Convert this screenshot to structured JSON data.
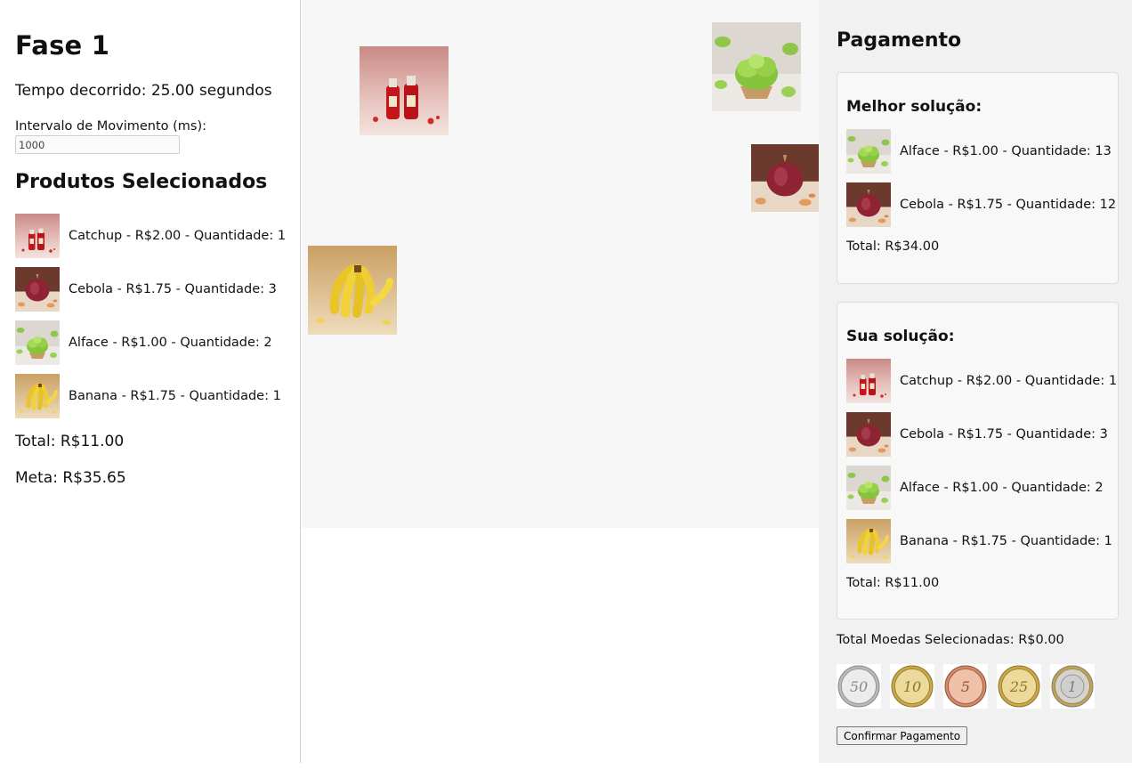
{
  "left": {
    "title": "Fase 1",
    "elapsed": "Tempo decorrido: 25.00 segundos",
    "interval_label": "Intervalo de Movimento (ms):",
    "interval_value": "1000",
    "selected_heading": "Produtos Selecionados",
    "items": [
      {
        "icon": "ketchup-image",
        "text": "Catchup - R$2.00 - Quantidade: 1"
      },
      {
        "icon": "onion-image",
        "text": "Cebola - R$1.75 - Quantidade: 3"
      },
      {
        "icon": "lettuce-image",
        "text": "Alface - R$1.00 - Quantidade: 2"
      },
      {
        "icon": "banana-image",
        "text": "Banana - R$1.75 - Quantidade: 1"
      }
    ],
    "total": "Total: R$11.00",
    "goal": "Meta: R$35.65"
  },
  "game_area": {
    "products": [
      "ketchup-image",
      "lettuce-image",
      "onion-image",
      "banana-image"
    ]
  },
  "payment": {
    "heading": "Pagamento",
    "best": {
      "heading": "Melhor solução:",
      "items": [
        {
          "icon": "lettuce-image",
          "text": "Alface - R$1.00 - Quantidade: 13"
        },
        {
          "icon": "onion-image",
          "text": "Cebola - R$1.75 - Quantidade: 12"
        }
      ],
      "total": "Total: R$34.00"
    },
    "yours": {
      "heading": "Sua solução:",
      "items": [
        {
          "icon": "ketchup-image",
          "text": "Catchup - R$2.00 - Quantidade: 1"
        },
        {
          "icon": "onion-image",
          "text": "Cebola - R$1.75 - Quantidade: 3"
        },
        {
          "icon": "lettuce-image",
          "text": "Alface - R$1.00 - Quantidade: 2"
        },
        {
          "icon": "banana-image",
          "text": "Banana - R$1.75 - Quantidade: 1"
        }
      ],
      "total": "Total: R$11.00"
    },
    "coins_total": "Total Moedas Selecionadas: R$0.00",
    "coins": [
      {
        "name": "coin-50-icon",
        "label": "50",
        "metal": "silver"
      },
      {
        "name": "coin-10-icon",
        "label": "10",
        "metal": "gold"
      },
      {
        "name": "coin-5-icon",
        "label": "5",
        "metal": "copper"
      },
      {
        "name": "coin-25-icon",
        "label": "25",
        "metal": "gold"
      },
      {
        "name": "coin-1-real-icon",
        "label": "1",
        "metal": "bimetal"
      }
    ],
    "confirm_label": "Confirmar Pagamento"
  }
}
